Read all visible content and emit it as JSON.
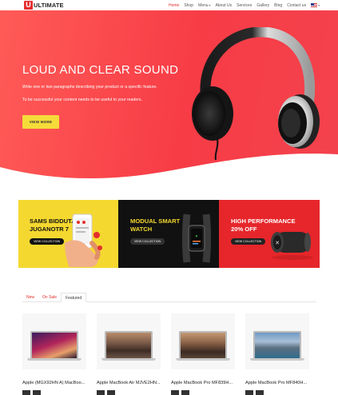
{
  "header": {
    "logo_letter": "U",
    "logo_text": "ULTIMATE",
    "nav": [
      "Home",
      "Shop",
      "Menu",
      "About Us",
      "Services",
      "Gallery",
      "Blog",
      "Contact us"
    ],
    "active_nav": "Home",
    "caret": "▾"
  },
  "hero": {
    "title": "LOUD AND CLEAR SOUND",
    "paragraph_1": "Write one or two paragraphs describing your product or a specific feature.",
    "paragraph_2": "To be successful your content needs to be useful to your readers.",
    "button_label": "VIEW MORE"
  },
  "promos": [
    {
      "line1": "SAMS BIDDUTATON",
      "line2": "JUGANOTR 7",
      "button": "VIEW COLLECTION"
    },
    {
      "line1": "MODUAL SMART",
      "line2": "WATCH",
      "button": "VIEW COLLECTION"
    },
    {
      "line1": "HIGH PERFORMANCE",
      "line2": "20% OFF",
      "button": "VIEW COLLECTION"
    }
  ],
  "tabs": [
    "New",
    "On Sale",
    "Featured"
  ],
  "active_tab": "Featured",
  "products": [
    {
      "name": "Apple (MGX92HN A) MacBoo..."
    },
    {
      "name": "Apple MacBook Air MJVE2HN..."
    },
    {
      "name": "Apple MacBook Pro MF839H..."
    },
    {
      "name": "Apple MacBook Pro MF840H..."
    }
  ],
  "colors": {
    "accent": "#e52e2e",
    "hero_bg": "#f73c46",
    "yellow": "#f5d82f"
  }
}
